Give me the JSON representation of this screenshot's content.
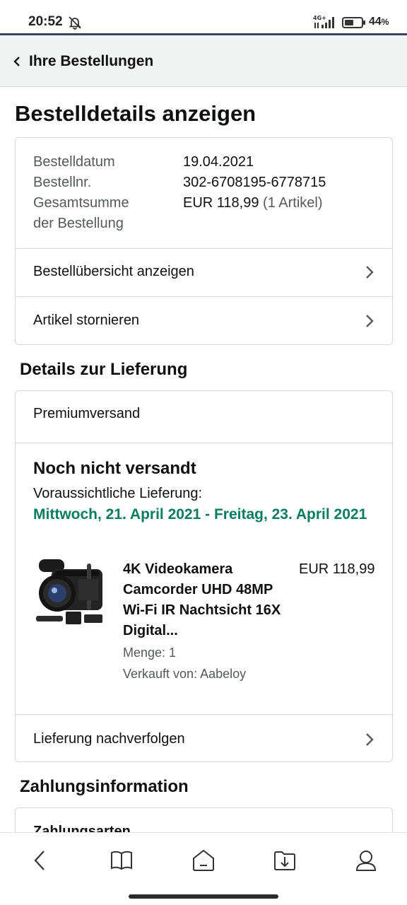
{
  "status_bar": {
    "time": "20:52",
    "network": "4G+",
    "battery": "44",
    "battery_unit": "%"
  },
  "header": {
    "back_label": "Ihre Bestellungen"
  },
  "page_title": "Bestelldetails anzeigen",
  "order": {
    "date_label": "Bestelldatum",
    "date_value": "19.04.2021",
    "number_label": "Bestellnr.",
    "number_value": "302-6708195-6778715",
    "total_label_line1": "Gesamtsumme",
    "total_label_line2": "der Bestellung",
    "total_value": "EUR 118,99",
    "total_items": "(1 Artikel)",
    "summary_link": "Bestellübersicht anzeigen",
    "cancel_link": "Artikel stornieren"
  },
  "delivery": {
    "section_title": "Details zur Lieferung",
    "shipping_method": "Premiumversand",
    "status": "Noch nicht versandt",
    "expected_label": "Voraussichtliche Lieferung:",
    "expected_date": "Mittwoch, 21. April 2021 - Freitag, 23. April 2021",
    "product": {
      "title": "4K Videokamera Camcorder UHD 48MP Wi-Fi IR Nachtsicht 16X Digital...",
      "price": "EUR 118,99",
      "quantity": "Menge: 1",
      "seller": "Verkauft von: Aabeloy"
    },
    "track_link": "Lieferung nachverfolgen"
  },
  "payment": {
    "section_title": "Zahlungsinformation",
    "first_row": "Zahlungsarten"
  },
  "bottom_nav": {
    "icons": [
      "back-icon",
      "book-icon",
      "home-icon",
      "downloads-folder-icon",
      "account-icon"
    ]
  },
  "colors": {
    "delivery_green": "#067d62",
    "header_bg": "#f2f3f3",
    "text_secondary": "#565959",
    "border": "#d5d9d9",
    "statusbar_rule": "#37475a"
  }
}
